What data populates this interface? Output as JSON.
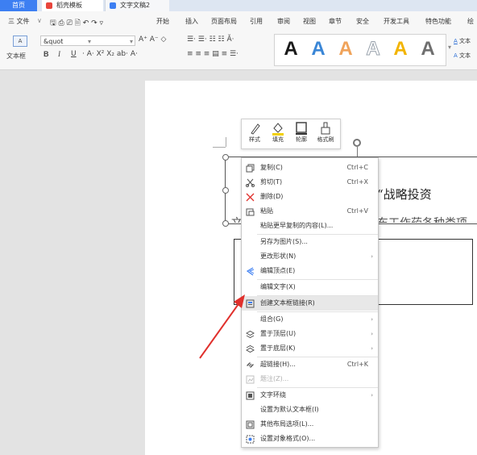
{
  "tabs": [
    {
      "label": "首页"
    },
    {
      "label": "稻壳模板"
    },
    {
      "label": "文字文稿2"
    }
  ],
  "menubar": {
    "file_label": "三 文件",
    "items": [
      "开始",
      "插入",
      "页面布局",
      "引用",
      "审阅",
      "视图",
      "章节",
      "安全",
      "开发工具",
      "特色功能",
      "绘"
    ]
  },
  "ribbon": {
    "textbox_label": "文本框",
    "font_value": "&quot",
    "bold": "B",
    "italic": "I",
    "underline": "U",
    "art_letter": "A",
    "right_labels": [
      "文本",
      "文本"
    ]
  },
  "colors": {
    "accent": "#3d7ff2",
    "art_black": "#1a1a1a",
    "art_blue": "#3a86d6",
    "art_orange": "#f0a35a",
    "art_gray": "#9aa3ad",
    "art_yellow": "#f2b400",
    "art_darkgray": "#6f6f6f",
    "arrow": "#e0302c"
  },
  "mini_toolbar": {
    "items": [
      {
        "label": "样式",
        "icon": "style-icon"
      },
      {
        "label": "填充",
        "icon": "fill-icon"
      },
      {
        "label": "轮廓",
        "icon": "outline-icon"
      },
      {
        "label": "格式刷",
        "icon": "format-painter-icon"
      }
    ]
  },
  "document": {
    "text_line1": "“战略投资",
    "text_line2": "文",
    "text_line2b": "东工作药各种类项"
  },
  "context_menu": {
    "items": [
      {
        "label": "复制(C)",
        "shortcut": "Ctrl+C"
      },
      {
        "label": "剪切(T)",
        "shortcut": "Ctrl+X"
      },
      {
        "label": "删除(D)",
        "shortcut": ""
      },
      {
        "label": "粘贴",
        "shortcut": "Ctrl+V"
      },
      {
        "label": "粘贴更早复制的内容(L)...",
        "shortcut": ""
      },
      {
        "label": "另存为图片(S)...",
        "shortcut": ""
      },
      {
        "label": "更改形状(N)",
        "shortcut": ""
      },
      {
        "label": "编辑顶点(E)",
        "shortcut": ""
      },
      {
        "label": "编辑文字(X)",
        "shortcut": ""
      },
      {
        "label": "创建文本框链接(R)",
        "shortcut": ""
      },
      {
        "label": "组合(G)",
        "shortcut": ""
      },
      {
        "label": "置于顶层(U)",
        "shortcut": ""
      },
      {
        "label": "置于底层(K)",
        "shortcut": ""
      },
      {
        "label": "超链接(H)...",
        "shortcut": "Ctrl+K"
      },
      {
        "label": "题注(Z)...",
        "shortcut": ""
      },
      {
        "label": "文字环绕",
        "shortcut": ""
      },
      {
        "label": "设置为默认文本框(I)",
        "shortcut": ""
      },
      {
        "label": "其他布局选项(L)...",
        "shortcut": ""
      },
      {
        "label": "设置对象格式(O)...",
        "shortcut": ""
      }
    ]
  }
}
